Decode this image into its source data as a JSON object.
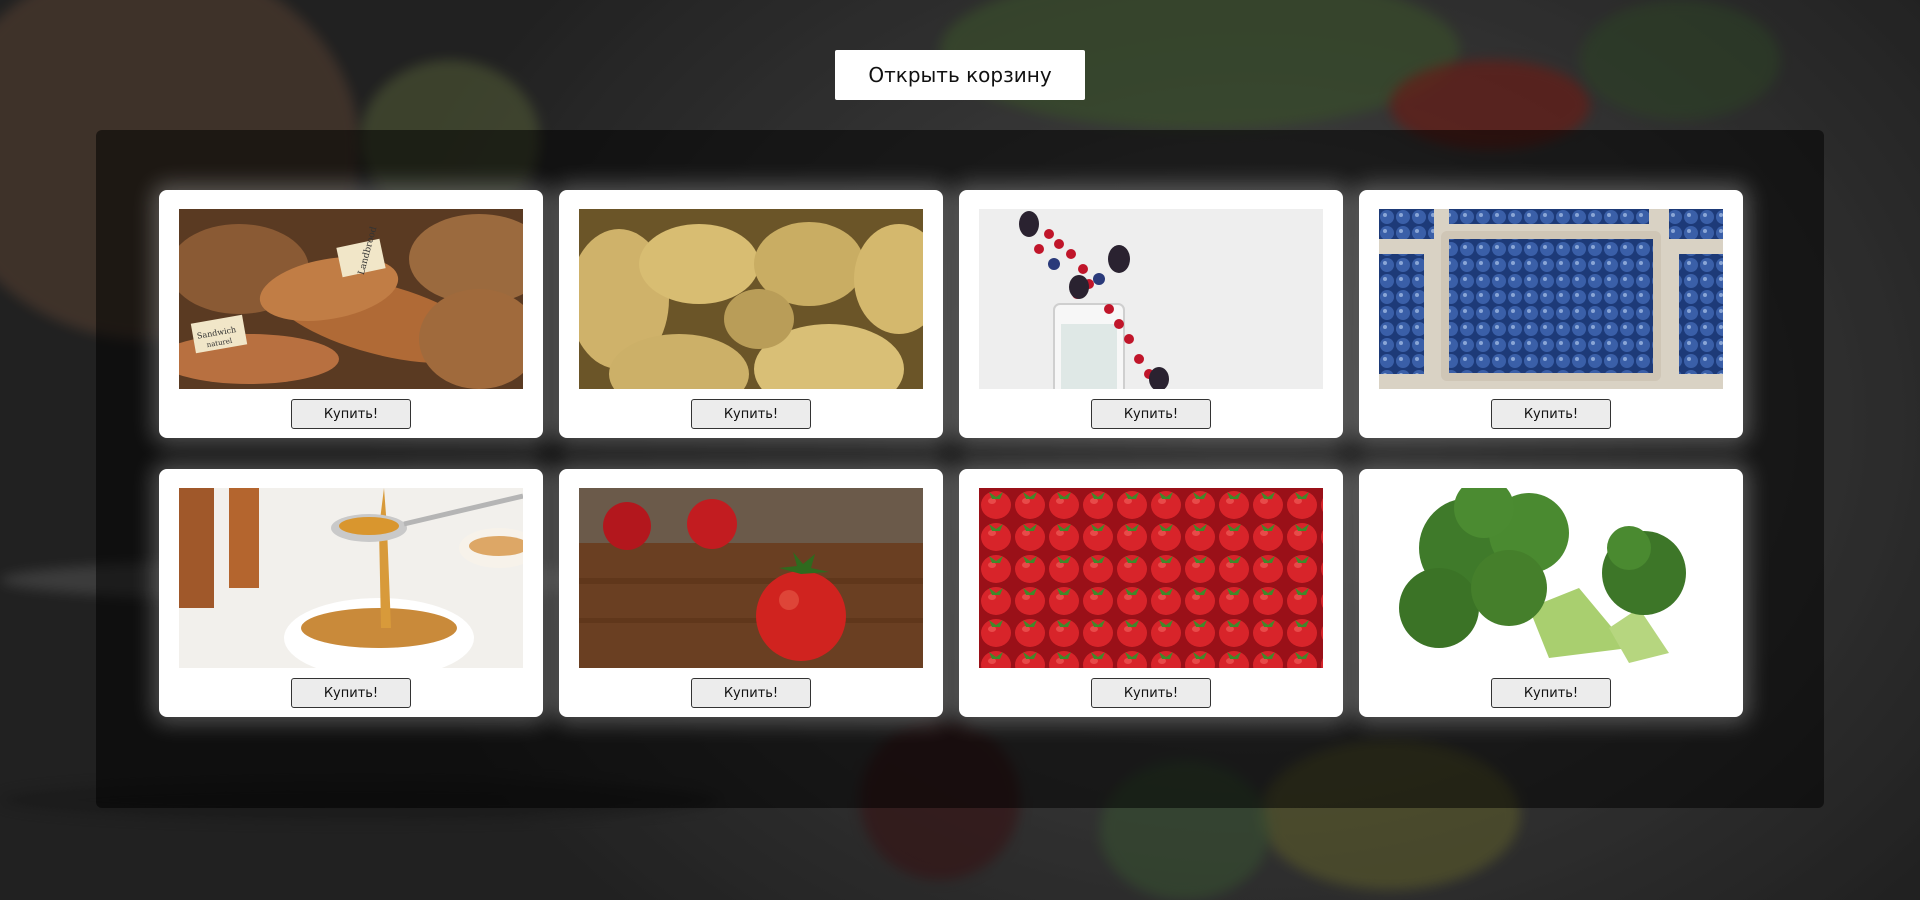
{
  "header": {
    "open_cart_label": "Открыть корзину"
  },
  "products": [
    {
      "image": "bread-photo",
      "buy_label": "Купить!",
      "tags": [
        "Landbrood",
        "Sandwich"
      ],
      "tags2": "naturel"
    },
    {
      "image": "potatoes-photo",
      "buy_label": "Купить!"
    },
    {
      "image": "berries-glass-photo",
      "buy_label": "Купить!"
    },
    {
      "image": "blueberries-photo",
      "buy_label": "Купить!"
    },
    {
      "image": "honey-spoon-photo",
      "buy_label": "Купить!"
    },
    {
      "image": "tomatoes-photo",
      "buy_label": "Купить!"
    },
    {
      "image": "strawberries-photo",
      "buy_label": "Купить!"
    },
    {
      "image": "broccoli-photo",
      "buy_label": "Купить!"
    }
  ],
  "colors": {
    "card_bg": "#ffffff",
    "panel": "rgba(0,0,0,0.52)",
    "button_bg": "#ececec"
  }
}
